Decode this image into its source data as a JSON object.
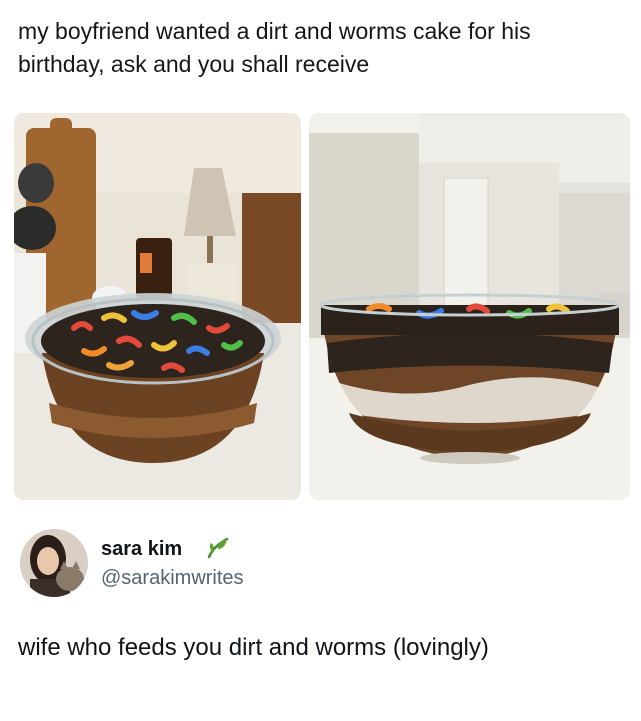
{
  "post": {
    "text": "my boyfriend wanted a dirt and worms cake for his birthday, ask and you shall receive"
  },
  "photos": [
    {
      "label": "bowl-top-view"
    },
    {
      "label": "bowl-side-view"
    }
  ],
  "reply": {
    "author_name": "sara kim",
    "author_handle": "@sarakimwrites",
    "badge_icon": "leaf-icon",
    "text": "wife who feeds you dirt and worms (lovingly)"
  },
  "colors": {
    "text": "#0f1419",
    "handle": "#536471",
    "leaf": "#4a8b2c"
  }
}
